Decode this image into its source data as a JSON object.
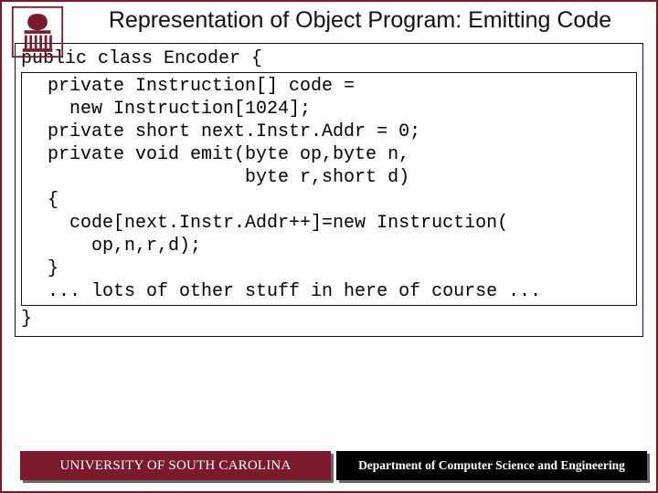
{
  "slide": {
    "title": "Representation of Object Program: Emitting Code"
  },
  "code": {
    "outer_open": "public class Encoder {",
    "inner_lines": [
      "  private Instruction[] code =",
      "    new Instruction[1024];",
      "  private short next.Instr.Addr = 0;",
      "",
      "  private void emit(byte op,byte n,",
      "                    byte r,short d)",
      "  {",
      "    code[next.Instr.Addr++]=new Instruction(",
      "      op,n,r,d);",
      "  }",
      "",
      "  ... lots of other stuff in here of course ..."
    ],
    "outer_close": "}"
  },
  "footer": {
    "left": "UNIVERSITY OF SOUTH CAROLINA",
    "right": "Department of Computer Science and Engineering"
  }
}
